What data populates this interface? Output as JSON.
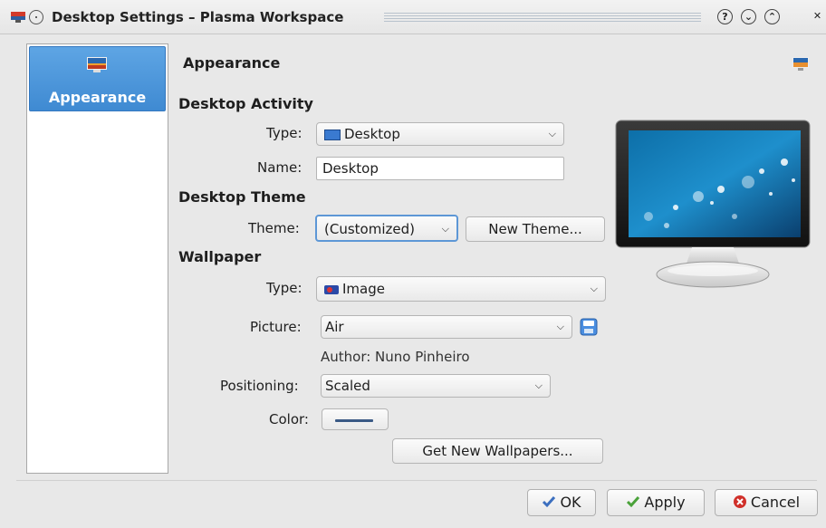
{
  "window": {
    "title": "Desktop Settings – Plasma Workspace",
    "buttons": [
      "?",
      "⌄",
      "⌃",
      "✕"
    ]
  },
  "sidebar": {
    "items": [
      {
        "label": "Appearance",
        "icon": "desktop-icon"
      }
    ]
  },
  "page": {
    "title": "Appearance"
  },
  "desktop_activity": {
    "section": "Desktop Activity",
    "type_label": "Type:",
    "type_value": "Desktop",
    "name_label": "Name:",
    "name_value": "Desktop"
  },
  "desktop_theme": {
    "section": "Desktop Theme",
    "theme_label": "Theme:",
    "theme_value": "(Customized)",
    "new_theme_button": "New Theme..."
  },
  "wallpaper": {
    "section": "Wallpaper",
    "type_label": "Type:",
    "type_value": "Image",
    "picture_label": "Picture:",
    "picture_value": "Air",
    "author": "Author: Nuno Pinheiro",
    "positioning_label": "Positioning:",
    "positioning_value": "Scaled",
    "color_label": "Color:",
    "color_value": "#3a5a85",
    "get_new_button": "Get New Wallpapers..."
  },
  "footer": {
    "ok": "OK",
    "apply": "Apply",
    "cancel": "Cancel"
  },
  "colors": {
    "accent": "#4a93d8",
    "ok_check": "#3c6fbf",
    "apply_check": "#4aa23a",
    "cancel": "#d0302a"
  }
}
